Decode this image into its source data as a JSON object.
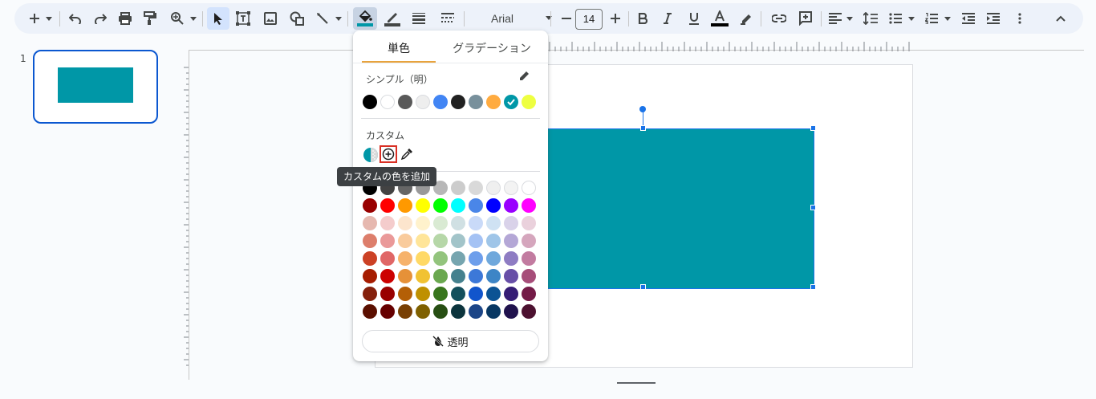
{
  "toolbar": {
    "font_name": "Arial",
    "font_size": "14",
    "icons": [
      "add-icon",
      "dropdown-icon",
      "undo-icon",
      "redo-icon",
      "print-icon",
      "paint-format-icon",
      "zoom-icon",
      "select-icon",
      "textbox-icon",
      "image-icon",
      "shape-icon",
      "line-icon",
      "fill-color-icon",
      "border-color-icon",
      "border-weight-icon",
      "border-dash-icon",
      "bold-icon",
      "italic-icon",
      "underline-icon",
      "text-color-icon",
      "highlight-icon",
      "link-icon",
      "comment-icon",
      "align-icon",
      "line-spacing-icon",
      "bulleted-list-icon",
      "numbered-list-icon",
      "decrease-indent-icon",
      "increase-indent-icon",
      "more-icon",
      "collapse-icon"
    ]
  },
  "filmstrip": {
    "slide_number": "1"
  },
  "fill_popup": {
    "tabs": [
      "単色",
      "グラデーション"
    ],
    "simple_label": "シンプル（明）",
    "custom_label": "カスタム",
    "tooltip": "カスタムの色を追加",
    "transparent_label": "透明",
    "simple_colors": [
      "#000000",
      "#ffffff",
      "#595959",
      "#eeeeee",
      "#4285f4",
      "#212121",
      "#78909c",
      "#ffab40",
      "#0097a7",
      "#eeff41"
    ],
    "selected_color": "#0097a7",
    "grid_colors": [
      [
        "#000000",
        "#434343",
        "#666666",
        "#999999",
        "#b7b7b7",
        "#cccccc",
        "#d9d9d9",
        "#efefef",
        "#f3f3f3",
        "#ffffff"
      ],
      [
        "#980000",
        "#ff0000",
        "#ff9900",
        "#ffff00",
        "#00ff00",
        "#00ffff",
        "#4a86e8",
        "#0000ff",
        "#9900ff",
        "#ff00ff"
      ],
      [
        "#e6b8af",
        "#f4cccc",
        "#fce5cd",
        "#fff2cc",
        "#d9ead3",
        "#d0e0e3",
        "#c9daf8",
        "#cfe2f3",
        "#d9d2e9",
        "#ead1dc"
      ],
      [
        "#dd7e6b",
        "#ea9999",
        "#f9cb9c",
        "#ffe599",
        "#b6d7a8",
        "#a2c4c9",
        "#a4c2f4",
        "#9fc5e8",
        "#b4a7d6",
        "#d5a6bd"
      ],
      [
        "#cc4125",
        "#e06666",
        "#f6b26b",
        "#ffd966",
        "#93c47d",
        "#76a5af",
        "#6d9eeb",
        "#6fa8dc",
        "#8e7cc3",
        "#c27ba0"
      ],
      [
        "#a61c00",
        "#cc0000",
        "#e69138",
        "#f1c232",
        "#6aa84f",
        "#45818e",
        "#3c78d8",
        "#3d85c6",
        "#674ea7",
        "#a64d79"
      ],
      [
        "#85200c",
        "#990000",
        "#b45f06",
        "#bf9000",
        "#38761d",
        "#134f5c",
        "#1155cc",
        "#0b5394",
        "#351c75",
        "#741b47"
      ],
      [
        "#5b0f00",
        "#660000",
        "#783f04",
        "#7f6000",
        "#274e13",
        "#0c343d",
        "#1c4587",
        "#073763",
        "#20124d",
        "#4c1130"
      ]
    ]
  },
  "shape": {
    "fill": "#0097a7"
  }
}
